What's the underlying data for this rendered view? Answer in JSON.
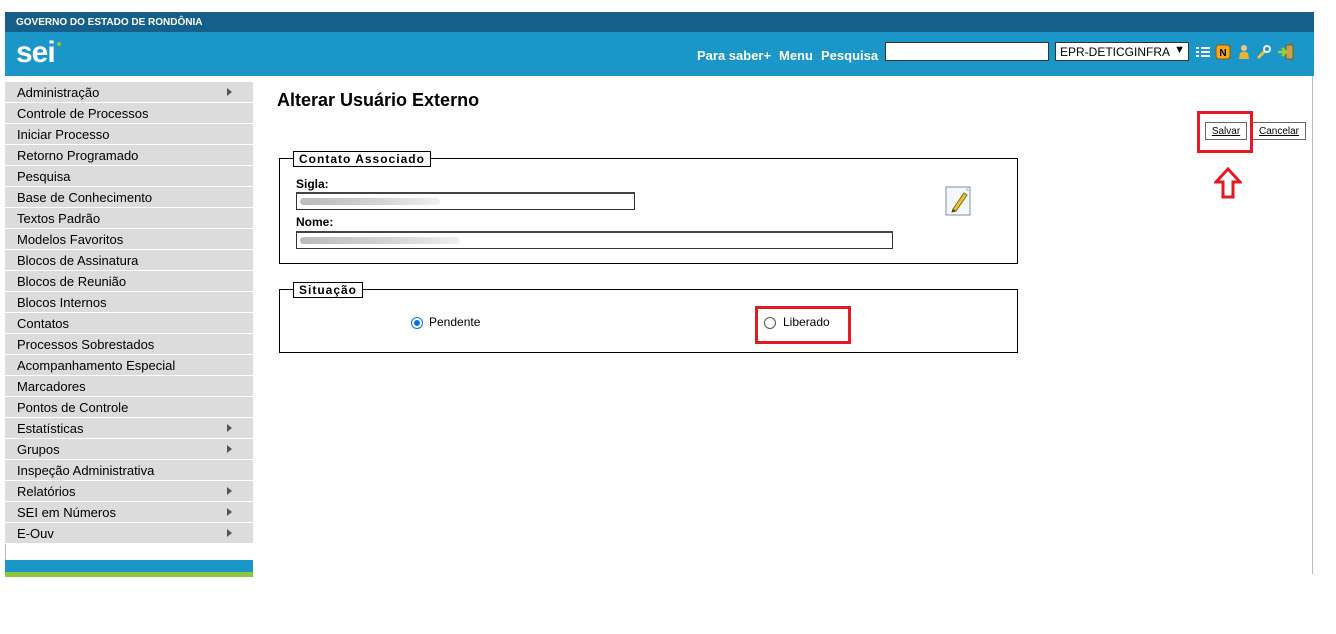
{
  "header": {
    "government_label": "GOVERNO DO ESTADO DE RONDÔNIA",
    "logo": "sei",
    "nav_para_saber": "Para saber+",
    "nav_menu": "Menu",
    "nav_pesquisa": "Pesquisa",
    "search_value": "",
    "unit_selected": "EPR-DETICGINFRA",
    "icons": [
      "list-icon",
      "notes-icon",
      "user-icon",
      "tools-icon",
      "exit-icon"
    ]
  },
  "sidebar": {
    "items": [
      {
        "label": "Administração",
        "has_submenu": true
      },
      {
        "label": "Controle de Processos",
        "has_submenu": false
      },
      {
        "label": "Iniciar Processo",
        "has_submenu": false
      },
      {
        "label": "Retorno Programado",
        "has_submenu": false
      },
      {
        "label": "Pesquisa",
        "has_submenu": false
      },
      {
        "label": "Base de Conhecimento",
        "has_submenu": false
      },
      {
        "label": "Textos Padrão",
        "has_submenu": false
      },
      {
        "label": "Modelos Favoritos",
        "has_submenu": false
      },
      {
        "label": "Blocos de Assinatura",
        "has_submenu": false
      },
      {
        "label": "Blocos de Reunião",
        "has_submenu": false
      },
      {
        "label": "Blocos Internos",
        "has_submenu": false
      },
      {
        "label": "Contatos",
        "has_submenu": false
      },
      {
        "label": "Processos Sobrestados",
        "has_submenu": false
      },
      {
        "label": "Acompanhamento Especial",
        "has_submenu": false
      },
      {
        "label": "Marcadores",
        "has_submenu": false
      },
      {
        "label": "Pontos de Controle",
        "has_submenu": false
      },
      {
        "label": "Estatísticas",
        "has_submenu": true
      },
      {
        "label": "Grupos",
        "has_submenu": true
      },
      {
        "label": "Inspeção Administrativa",
        "has_submenu": false
      },
      {
        "label": "Relatórios",
        "has_submenu": true
      },
      {
        "label": "SEI em Números",
        "has_submenu": true
      },
      {
        "label": "E-Ouv",
        "has_submenu": true
      }
    ]
  },
  "main": {
    "title": "Alterar Usuário Externo",
    "save_label": "Salvar",
    "cancel_label": "Cancelar",
    "contato": {
      "legend": "Contato Associado",
      "sigla_label": "Sigla:",
      "nome_label": "Nome:"
    },
    "situacao": {
      "legend": "Situação",
      "options": [
        {
          "label": "Pendente",
          "checked": true
        },
        {
          "label": "Liberado",
          "checked": false
        }
      ]
    }
  },
  "colors": {
    "header_blue": "#1a97c8",
    "gov_bar": "#155f8a",
    "highlight_red": "#e31a22",
    "accent_green": "#8cc63f"
  }
}
